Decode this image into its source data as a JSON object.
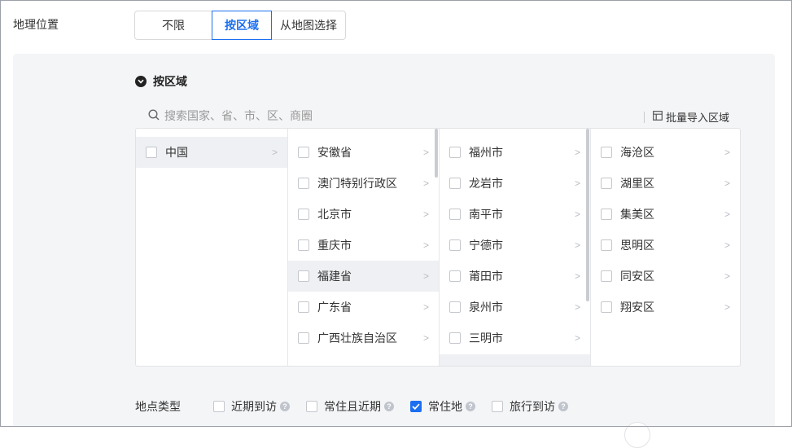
{
  "geo": {
    "label": "地理位置",
    "options": [
      "不限",
      "按区域",
      "从地图选择"
    ],
    "active_index": 1
  },
  "region": {
    "title": "按区域",
    "search_placeholder": "搜索国家、省、市、区、商圈",
    "batch_import": "批量导入区域",
    "columns": [
      {
        "items": [
          "中国"
        ],
        "selected": 0
      },
      {
        "items": [
          "安徽省",
          "澳门特别行政区",
          "北京市",
          "重庆市",
          "福建省",
          "广东省",
          "广西壮族自治区"
        ],
        "selected": 4
      },
      {
        "items": [
          "福州市",
          "龙岩市",
          "南平市",
          "宁德市",
          "莆田市",
          "泉州市",
          "三明市"
        ],
        "selected": -1
      },
      {
        "items": [
          "海沧区",
          "湖里区",
          "集美区",
          "思明区",
          "同安区",
          "翔安区"
        ],
        "selected": -1
      }
    ]
  },
  "location_type": {
    "label": "地点类型",
    "options": [
      {
        "label": "近期到访",
        "checked": false
      },
      {
        "label": "常住且近期",
        "checked": false
      },
      {
        "label": "常住地",
        "checked": true
      },
      {
        "label": "旅行到访",
        "checked": false
      }
    ]
  },
  "colors": {
    "accent": "#1c6ff0",
    "panel_bg": "#f4f5f7"
  },
  "icons": {
    "search": "search-icon",
    "batch": "table-icon",
    "chevron": "chevron-right-icon",
    "help": "help-circle-icon"
  }
}
